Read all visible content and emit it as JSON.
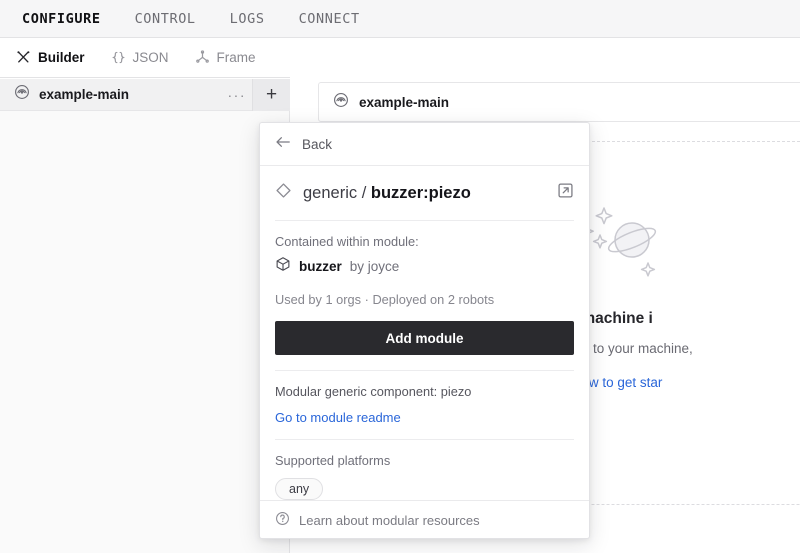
{
  "top_tabs": [
    {
      "label": "CONFIGURE",
      "active": true
    },
    {
      "label": "CONTROL",
      "active": false
    },
    {
      "label": "LOGS",
      "active": false
    },
    {
      "label": "CONNECT",
      "active": false
    }
  ],
  "sub_tabs": [
    {
      "label": "Builder",
      "icon": "tools-icon",
      "active": true
    },
    {
      "label": "JSON",
      "icon": "braces-icon",
      "active": false
    },
    {
      "label": "Frame",
      "icon": "frame-axis-icon",
      "active": false
    }
  ],
  "sidebar": {
    "tree_item": {
      "label": "example-main",
      "icon": "machine-signal-icon",
      "menu_label": "···",
      "add_label": "+"
    }
  },
  "main": {
    "machine_card": {
      "label": "example-main",
      "icon": "machine-signal-icon"
    },
    "empty_state": {
      "illustration": "planet-sparkles-icon",
      "title": "This machine i",
      "subtitle": "you add items to your machine,",
      "link": "Learn how to get star"
    }
  },
  "modal": {
    "back": {
      "label": "Back",
      "icon": "arrow-left-icon"
    },
    "header": {
      "icon": "diamond-icon",
      "namespace": "generic",
      "separator": " / ",
      "name": "buzzer:piezo",
      "external_icon": "external-link-icon"
    },
    "contained_label": "Contained within module:",
    "module": {
      "icon": "package-cube-icon",
      "name": "buzzer",
      "by": " by joyce"
    },
    "stats": "Used by 1 orgs · Deployed on 2 robots",
    "add_button": "Add module",
    "description": "Modular generic component: piezo",
    "readme_link": "Go to module readme",
    "platforms_label": "Supported platforms",
    "platforms": [
      "any"
    ],
    "footer": {
      "icon": "question-circle-icon",
      "label": "Learn about modular resources"
    }
  },
  "colors": {
    "accent_link": "#2a66d9",
    "button_dark": "#2a2a2e",
    "topbar_bg": "#f6f6f7",
    "sidebar_bg": "#fafafa"
  }
}
